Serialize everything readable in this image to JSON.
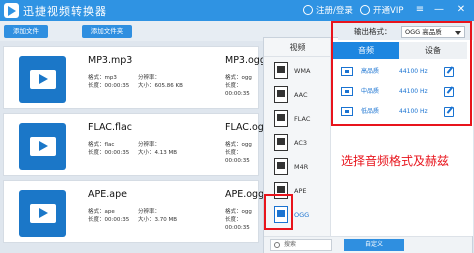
{
  "app": {
    "title": "迅捷视频转换器"
  },
  "titlebar": {
    "login": "注册/登录",
    "vip": "开通VIP",
    "menu_glyph": "≡",
    "minimize_glyph": "—",
    "close_glyph": "✕"
  },
  "toolbar": {
    "add_file": "添加文件",
    "add_folder": "添加文件夹"
  },
  "files": [
    {
      "src_name": "MP3.mp3",
      "dst_name": "MP3.ogg",
      "labels": {
        "format": "格式：",
        "resolution": "分辨率：",
        "duration": "长度：",
        "size": "大小："
      },
      "src": {
        "format": "mp3",
        "resolution": "",
        "duration": "00:00:35",
        "size": "605.86 KB"
      },
      "dst": {
        "format": "ogg",
        "resolution": "",
        "duration": "00:00:35",
        "size": ""
      }
    },
    {
      "src_name": "FLAC.flac",
      "dst_name": "FLAC.ogg",
      "labels": {
        "format": "格式：",
        "resolution": "分辨率：",
        "duration": "长度：",
        "size": "大小："
      },
      "src": {
        "format": "flac",
        "resolution": "",
        "duration": "00:00:35",
        "size": "4.13 MB"
      },
      "dst": {
        "format": "ogg",
        "resolution": "",
        "duration": "00:00:35",
        "size": ""
      }
    },
    {
      "src_name": "APE.ape",
      "dst_name": "APE.ogg",
      "labels": {
        "format": "格式：",
        "resolution": "分辨率：",
        "duration": "长度：",
        "size": "大小："
      },
      "src": {
        "format": "ape",
        "resolution": "",
        "duration": "00:00:35",
        "size": "3.70 MB"
      },
      "dst": {
        "format": "ogg",
        "resolution": "",
        "duration": "00:00:35",
        "size": ""
      }
    }
  ],
  "output_format": {
    "label": "输出格式：",
    "value": "OGG 高品质"
  },
  "format_panel": {
    "category_label": "视频",
    "formats": [
      "WMA",
      "AAC",
      "FLAC",
      "AC3",
      "M4R",
      "APE",
      "OGG"
    ],
    "selected_format": "OGG",
    "tabs": {
      "audio": "音频",
      "device": "设备"
    },
    "qualities": [
      {
        "name": "高品质",
        "rate": "44100 Hz"
      },
      {
        "name": "中品质",
        "rate": "44100 Hz"
      },
      {
        "name": "低品质",
        "rate": "44100 Hz"
      }
    ],
    "search_placeholder": "搜索",
    "custom_button": "自定义"
  },
  "annotation": "选择音频格式及赫兹",
  "colors": {
    "brand_blue": "#2f93e3",
    "highlight_red": "#e8141c",
    "link_blue": "#1a73d1"
  }
}
